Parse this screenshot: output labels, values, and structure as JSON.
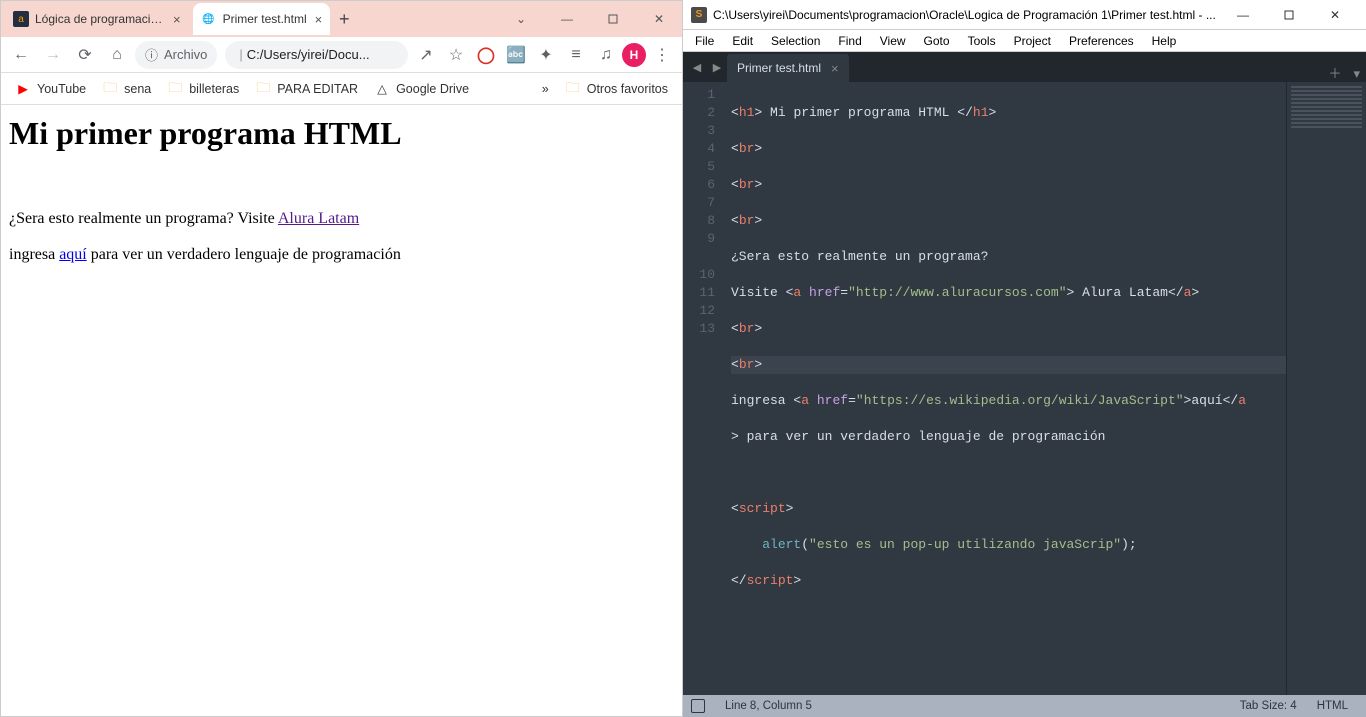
{
  "browser": {
    "tabs": [
      {
        "label": "Lógica de programación p",
        "active": false
      },
      {
        "label": "Primer test.html",
        "active": true
      }
    ],
    "url_pill_label": "Archivo",
    "url_sep": "|",
    "url": "C:/Users/yirei/Docu...",
    "avatar_letter": "H",
    "bookmarks": [
      {
        "label": "YouTube"
      },
      {
        "label": "sena"
      },
      {
        "label": "billeteras"
      },
      {
        "label": "PARA EDITAR"
      },
      {
        "label": "Google Drive"
      }
    ],
    "bookmarks_overflow": "»",
    "other_bookmarks": "Otros favoritos"
  },
  "page": {
    "heading": "Mi primer programa HTML",
    "p1_pre": "¿Sera esto realmente un programa? Visite ",
    "link1": "Alura Latam",
    "p2_pre": "ingresa ",
    "link2": "aquí",
    "p2_post": " para ver un verdadero lenguaje de programación"
  },
  "sublime": {
    "title": "C:\\Users\\yirei\\Documents\\programacion\\Oracle\\Logica de Programación 1\\Primer test.html - ...",
    "menu": [
      "File",
      "Edit",
      "Selection",
      "Find",
      "View",
      "Goto",
      "Tools",
      "Project",
      "Preferences",
      "Help"
    ],
    "tab": "Primer test.html",
    "lines": [
      "1",
      "2",
      "3",
      "4",
      "5",
      "6",
      "7",
      "8",
      "9",
      "",
      "10",
      "11",
      "12",
      "13"
    ],
    "status_left": "Line 8, Column 5",
    "status_tab": "Tab Size: 4",
    "status_lang": "HTML",
    "code": {
      "l1": {
        "a": "<",
        "b": "h1",
        "c": ">",
        "d": " Mi primer programa HTML ",
        "e": "</",
        "f": "h1",
        "g": ">"
      },
      "l2": {
        "a": "<",
        "b": "br",
        "c": ">"
      },
      "l3": {
        "a": "<",
        "b": "br",
        "c": ">"
      },
      "l4": {
        "a": "<",
        "b": "br",
        "c": ">"
      },
      "l5": {
        "t": "¿Sera esto realmente un programa?"
      },
      "l6": {
        "a": "Visite ",
        "b": "<",
        "c": "a",
        "d": " ",
        "e": "href",
        "f": "=",
        "g": "\"http://www.aluracursos.com\"",
        "h": ">",
        "i": " Alura Latam",
        "j": "</",
        "k": "a",
        "l": ">"
      },
      "l7": {
        "a": "<",
        "b": "br",
        "c": ">"
      },
      "l8": {
        "a": "<",
        "b": "br",
        "c": ">"
      },
      "l9": {
        "a": "ingresa ",
        "b": "<",
        "c": "a",
        "d": " ",
        "e": "href",
        "f": "=",
        "g": "\"https://es.wikipedia.org/wiki/JavaScript\"",
        "h": ">",
        "i": "aquí",
        "j": "</",
        "k": "a"
      },
      "l9b": {
        "a": ">",
        "b": " para ver un verdadero lenguaje de programación"
      },
      "l11": {
        "a": "<",
        "b": "script",
        "c": ">"
      },
      "l12": {
        "a": "    ",
        "b": "alert",
        "c": "(",
        "d": "\"esto es un pop-up utilizando javaScrip\"",
        "e": ");"
      },
      "l13": {
        "a": "</",
        "b": "script",
        "c": ">"
      }
    }
  }
}
